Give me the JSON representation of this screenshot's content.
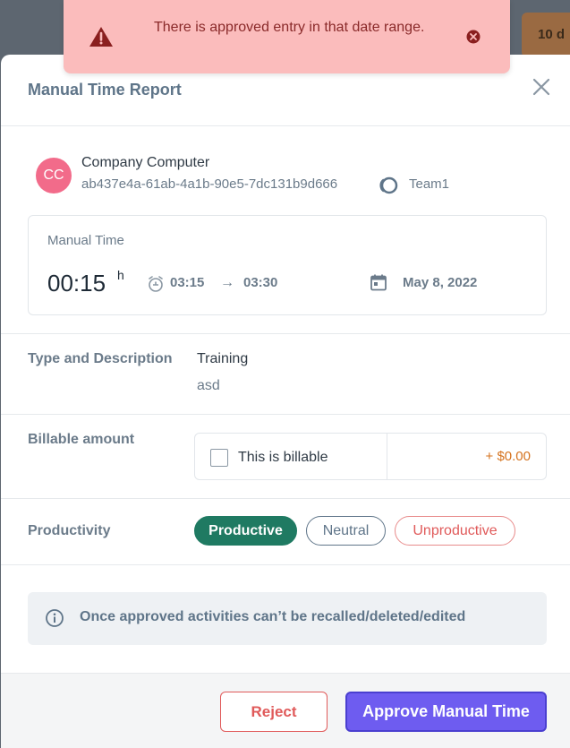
{
  "background": {
    "chip_text": "10 d"
  },
  "toast": {
    "message": "There is approved entry in that date range.",
    "icons": {
      "warning": "warning-icon",
      "close": "close-circle-icon"
    }
  },
  "modal": {
    "title": "Manual Time Report",
    "device": {
      "avatar_initials": "CC",
      "name": "Company Computer",
      "id": "ab437e4a-61ab-4a1b-90e5-7dc131b9d666",
      "team": "Team1"
    },
    "manual_time": {
      "label": "Manual Time",
      "duration": "00:15",
      "duration_unit": "h",
      "start": "03:15",
      "arrow": "→",
      "end": "03:30",
      "date": "May 8, 2022"
    },
    "type_description": {
      "label": "Type and Description",
      "type": "Training",
      "description": "asd"
    },
    "billable": {
      "label": "Billable amount",
      "checkbox_label": "This is billable",
      "checked": false,
      "amount": "+ $0.00"
    },
    "productivity": {
      "label": "Productivity",
      "options": [
        "Productive",
        "Neutral",
        "Unproductive"
      ],
      "selected": "Productive"
    },
    "info": "Once approved activities can’t be recalled/deleted/edited",
    "actions": {
      "reject": "Reject",
      "approve": "Approve Manual Time"
    }
  },
  "colors": {
    "accent": "#6e5cf0",
    "productive": "#1f7a62",
    "danger": "#e05a5a",
    "amount": "#d5731f",
    "toast_bg": "#fbbcbc"
  }
}
